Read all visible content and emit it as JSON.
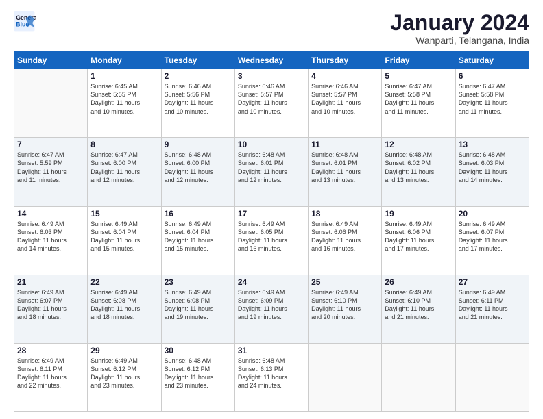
{
  "logo": {
    "line1": "General",
    "line2": "Blue"
  },
  "title": "January 2024",
  "subtitle": "Wanparti, Telangana, India",
  "headers": [
    "Sunday",
    "Monday",
    "Tuesday",
    "Wednesday",
    "Thursday",
    "Friday",
    "Saturday"
  ],
  "weeks": [
    [
      {
        "day": "",
        "detail": ""
      },
      {
        "day": "1",
        "detail": "Sunrise: 6:45 AM\nSunset: 5:55 PM\nDaylight: 11 hours\nand 10 minutes."
      },
      {
        "day": "2",
        "detail": "Sunrise: 6:46 AM\nSunset: 5:56 PM\nDaylight: 11 hours\nand 10 minutes."
      },
      {
        "day": "3",
        "detail": "Sunrise: 6:46 AM\nSunset: 5:57 PM\nDaylight: 11 hours\nand 10 minutes."
      },
      {
        "day": "4",
        "detail": "Sunrise: 6:46 AM\nSunset: 5:57 PM\nDaylight: 11 hours\nand 10 minutes."
      },
      {
        "day": "5",
        "detail": "Sunrise: 6:47 AM\nSunset: 5:58 PM\nDaylight: 11 hours\nand 11 minutes."
      },
      {
        "day": "6",
        "detail": "Sunrise: 6:47 AM\nSunset: 5:58 PM\nDaylight: 11 hours\nand 11 minutes."
      }
    ],
    [
      {
        "day": "7",
        "detail": "Sunrise: 6:47 AM\nSunset: 5:59 PM\nDaylight: 11 hours\nand 11 minutes."
      },
      {
        "day": "8",
        "detail": "Sunrise: 6:47 AM\nSunset: 6:00 PM\nDaylight: 11 hours\nand 12 minutes."
      },
      {
        "day": "9",
        "detail": "Sunrise: 6:48 AM\nSunset: 6:00 PM\nDaylight: 11 hours\nand 12 minutes."
      },
      {
        "day": "10",
        "detail": "Sunrise: 6:48 AM\nSunset: 6:01 PM\nDaylight: 11 hours\nand 12 minutes."
      },
      {
        "day": "11",
        "detail": "Sunrise: 6:48 AM\nSunset: 6:01 PM\nDaylight: 11 hours\nand 13 minutes."
      },
      {
        "day": "12",
        "detail": "Sunrise: 6:48 AM\nSunset: 6:02 PM\nDaylight: 11 hours\nand 13 minutes."
      },
      {
        "day": "13",
        "detail": "Sunrise: 6:48 AM\nSunset: 6:03 PM\nDaylight: 11 hours\nand 14 minutes."
      }
    ],
    [
      {
        "day": "14",
        "detail": "Sunrise: 6:49 AM\nSunset: 6:03 PM\nDaylight: 11 hours\nand 14 minutes."
      },
      {
        "day": "15",
        "detail": "Sunrise: 6:49 AM\nSunset: 6:04 PM\nDaylight: 11 hours\nand 15 minutes."
      },
      {
        "day": "16",
        "detail": "Sunrise: 6:49 AM\nSunset: 6:04 PM\nDaylight: 11 hours\nand 15 minutes."
      },
      {
        "day": "17",
        "detail": "Sunrise: 6:49 AM\nSunset: 6:05 PM\nDaylight: 11 hours\nand 16 minutes."
      },
      {
        "day": "18",
        "detail": "Sunrise: 6:49 AM\nSunset: 6:06 PM\nDaylight: 11 hours\nand 16 minutes."
      },
      {
        "day": "19",
        "detail": "Sunrise: 6:49 AM\nSunset: 6:06 PM\nDaylight: 11 hours\nand 17 minutes."
      },
      {
        "day": "20",
        "detail": "Sunrise: 6:49 AM\nSunset: 6:07 PM\nDaylight: 11 hours\nand 17 minutes."
      }
    ],
    [
      {
        "day": "21",
        "detail": "Sunrise: 6:49 AM\nSunset: 6:07 PM\nDaylight: 11 hours\nand 18 minutes."
      },
      {
        "day": "22",
        "detail": "Sunrise: 6:49 AM\nSunset: 6:08 PM\nDaylight: 11 hours\nand 18 minutes."
      },
      {
        "day": "23",
        "detail": "Sunrise: 6:49 AM\nSunset: 6:08 PM\nDaylight: 11 hours\nand 19 minutes."
      },
      {
        "day": "24",
        "detail": "Sunrise: 6:49 AM\nSunset: 6:09 PM\nDaylight: 11 hours\nand 19 minutes."
      },
      {
        "day": "25",
        "detail": "Sunrise: 6:49 AM\nSunset: 6:10 PM\nDaylight: 11 hours\nand 20 minutes."
      },
      {
        "day": "26",
        "detail": "Sunrise: 6:49 AM\nSunset: 6:10 PM\nDaylight: 11 hours\nand 21 minutes."
      },
      {
        "day": "27",
        "detail": "Sunrise: 6:49 AM\nSunset: 6:11 PM\nDaylight: 11 hours\nand 21 minutes."
      }
    ],
    [
      {
        "day": "28",
        "detail": "Sunrise: 6:49 AM\nSunset: 6:11 PM\nDaylight: 11 hours\nand 22 minutes."
      },
      {
        "day": "29",
        "detail": "Sunrise: 6:49 AM\nSunset: 6:12 PM\nDaylight: 11 hours\nand 23 minutes."
      },
      {
        "day": "30",
        "detail": "Sunrise: 6:48 AM\nSunset: 6:12 PM\nDaylight: 11 hours\nand 23 minutes."
      },
      {
        "day": "31",
        "detail": "Sunrise: 6:48 AM\nSunset: 6:13 PM\nDaylight: 11 hours\nand 24 minutes."
      },
      {
        "day": "",
        "detail": ""
      },
      {
        "day": "",
        "detail": ""
      },
      {
        "day": "",
        "detail": ""
      }
    ]
  ]
}
